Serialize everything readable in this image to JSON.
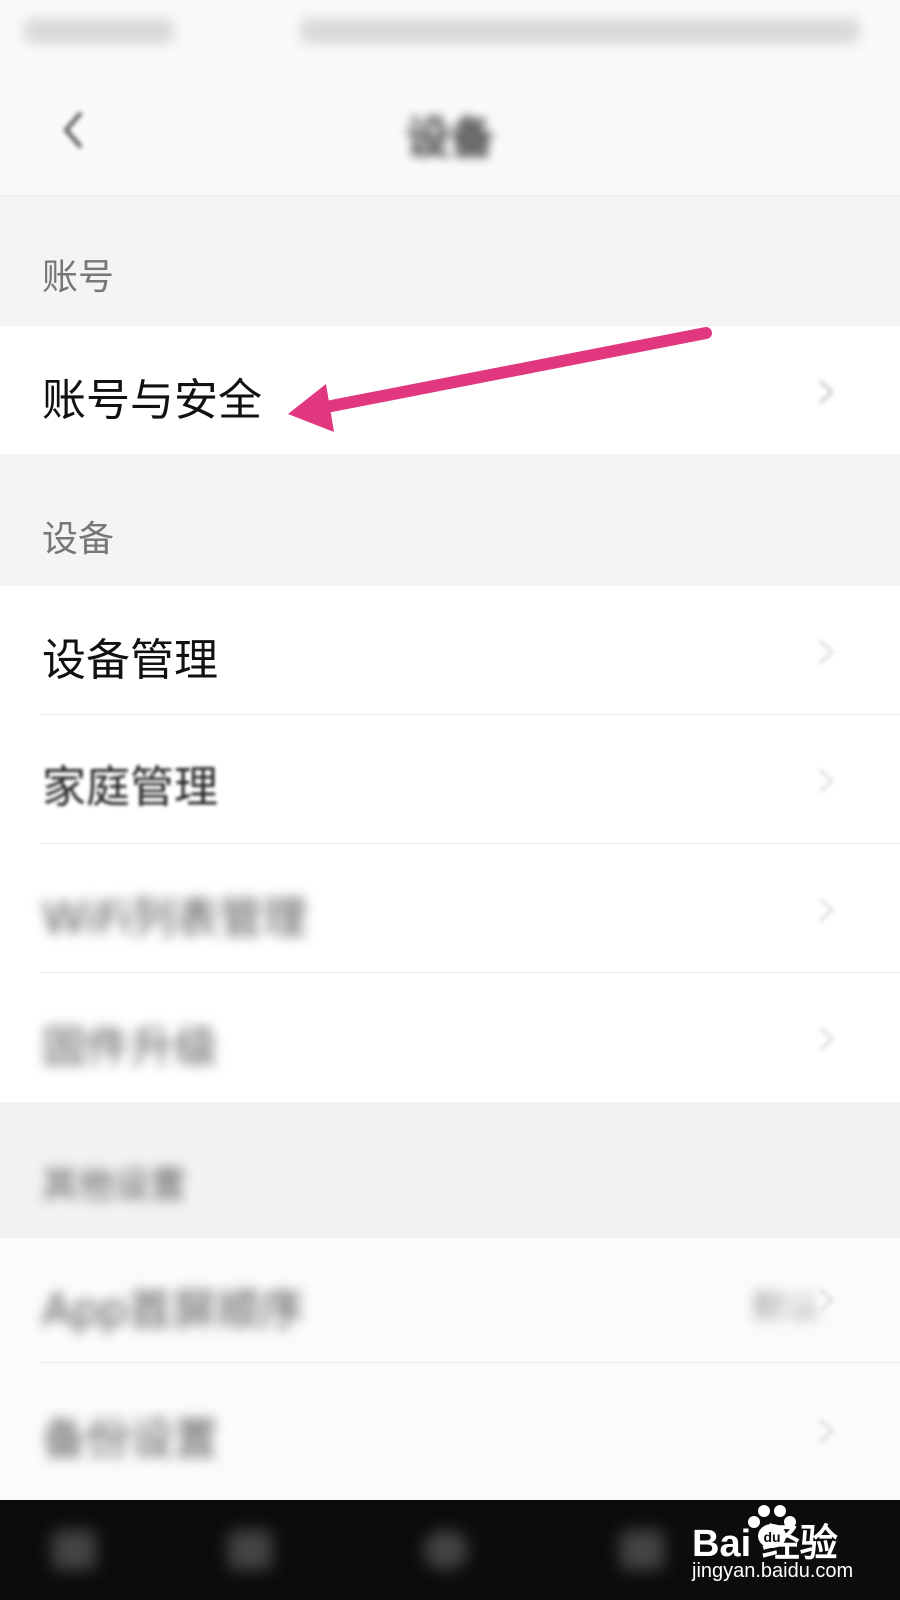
{
  "header": {
    "title": "设备"
  },
  "sections": [
    {
      "label": "账号",
      "items": [
        {
          "label": "账号与安全"
        }
      ]
    },
    {
      "label": "设备",
      "items": [
        {
          "label": "设备管理"
        },
        {
          "label": "家庭管理"
        },
        {
          "label": "WiFi列表管理"
        },
        {
          "label": "固件升级"
        }
      ]
    },
    {
      "label": "其他设置",
      "items": [
        {
          "label": "App首屏顺序",
          "value": "默认"
        },
        {
          "label": "备份设置"
        }
      ]
    }
  ],
  "annotation": {
    "arrow_color": "#e0377e"
  },
  "watermark": {
    "logo": "Bai  经验",
    "url": "jingyan.baidu.com"
  }
}
